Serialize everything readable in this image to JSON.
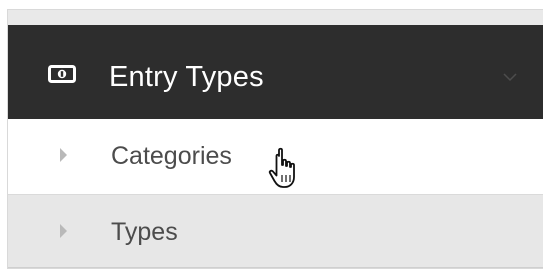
{
  "menu": {
    "header": {
      "icon": "money-icon",
      "title": "Entry Types",
      "chevron": "chevron-down-icon"
    },
    "items": [
      {
        "label": "Categories",
        "icon": "caret-right-icon",
        "state": "hover"
      },
      {
        "label": "Types",
        "icon": "caret-right-icon",
        "state": "normal"
      }
    ]
  },
  "cursor": {
    "icon": "hand-pointer-icon"
  },
  "colors": {
    "header_bg": "#2d2d2d",
    "header_text": "#ffffff",
    "item_hover_bg": "#ffffff",
    "item_bg": "#e7e7e7",
    "item_text": "#4c4c4c"
  }
}
